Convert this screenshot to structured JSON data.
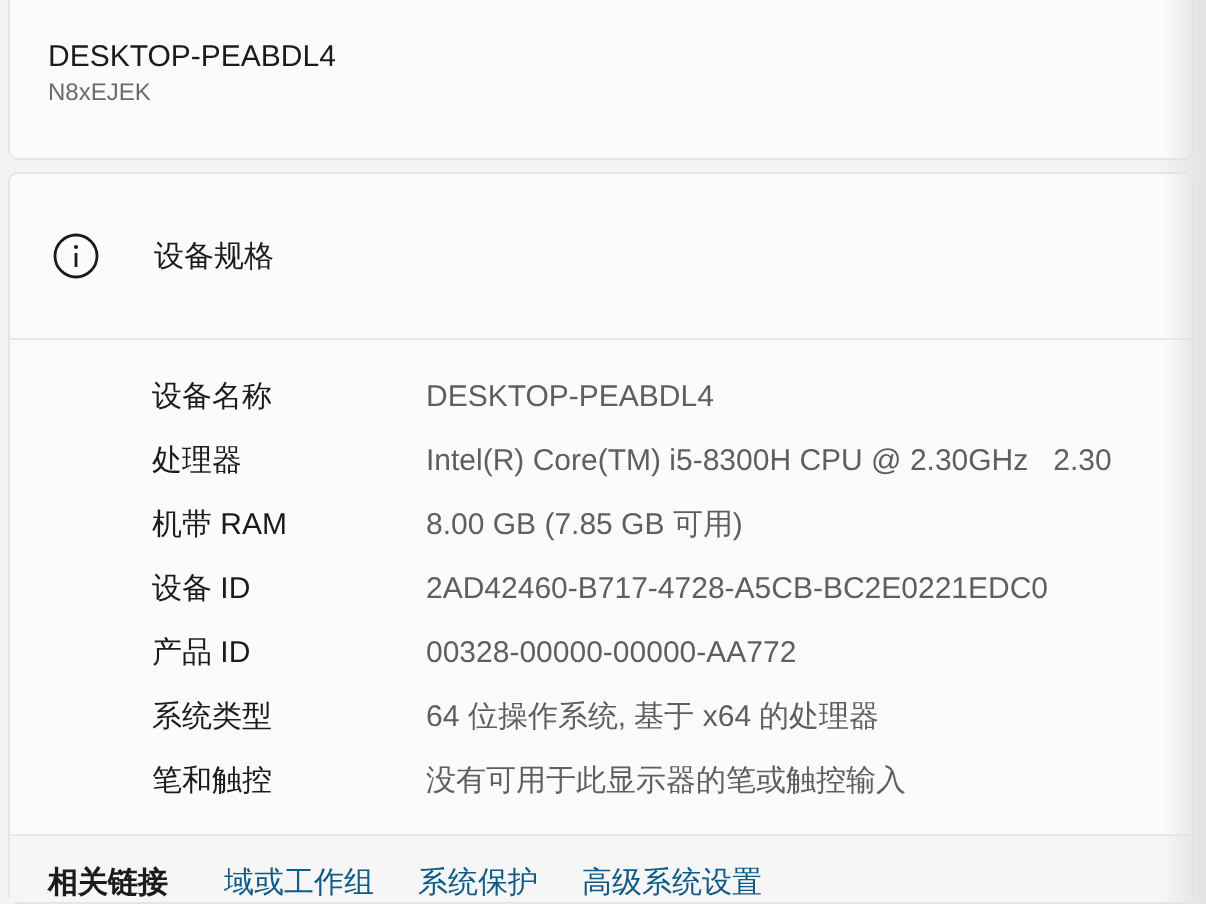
{
  "device_card": {
    "name": "DESKTOP-PEABDL4",
    "model": "N8xEJEK"
  },
  "specs": {
    "title": "设备规格",
    "rows": [
      {
        "label": "设备名称",
        "value": "DESKTOP-PEABDL4"
      },
      {
        "label": "处理器",
        "value": "Intel(R) Core(TM) i5-8300H CPU @ 2.30GHz   2.30"
      },
      {
        "label": "机带 RAM",
        "value": "8.00 GB (7.85 GB 可用)"
      },
      {
        "label": "设备 ID",
        "value": "2AD42460-B717-4728-A5CB-BC2E0221EDC0"
      },
      {
        "label": "产品 ID",
        "value": "00328-00000-00000-AA772"
      },
      {
        "label": "系统类型",
        "value": "64 位操作系统, 基于 x64 的处理器"
      },
      {
        "label": "笔和触控",
        "value": "没有可用于此显示器的笔或触控输入"
      }
    ]
  },
  "related_links": {
    "title": "相关链接",
    "links": [
      "域或工作组",
      "系统保护",
      "高级系统设置"
    ]
  }
}
